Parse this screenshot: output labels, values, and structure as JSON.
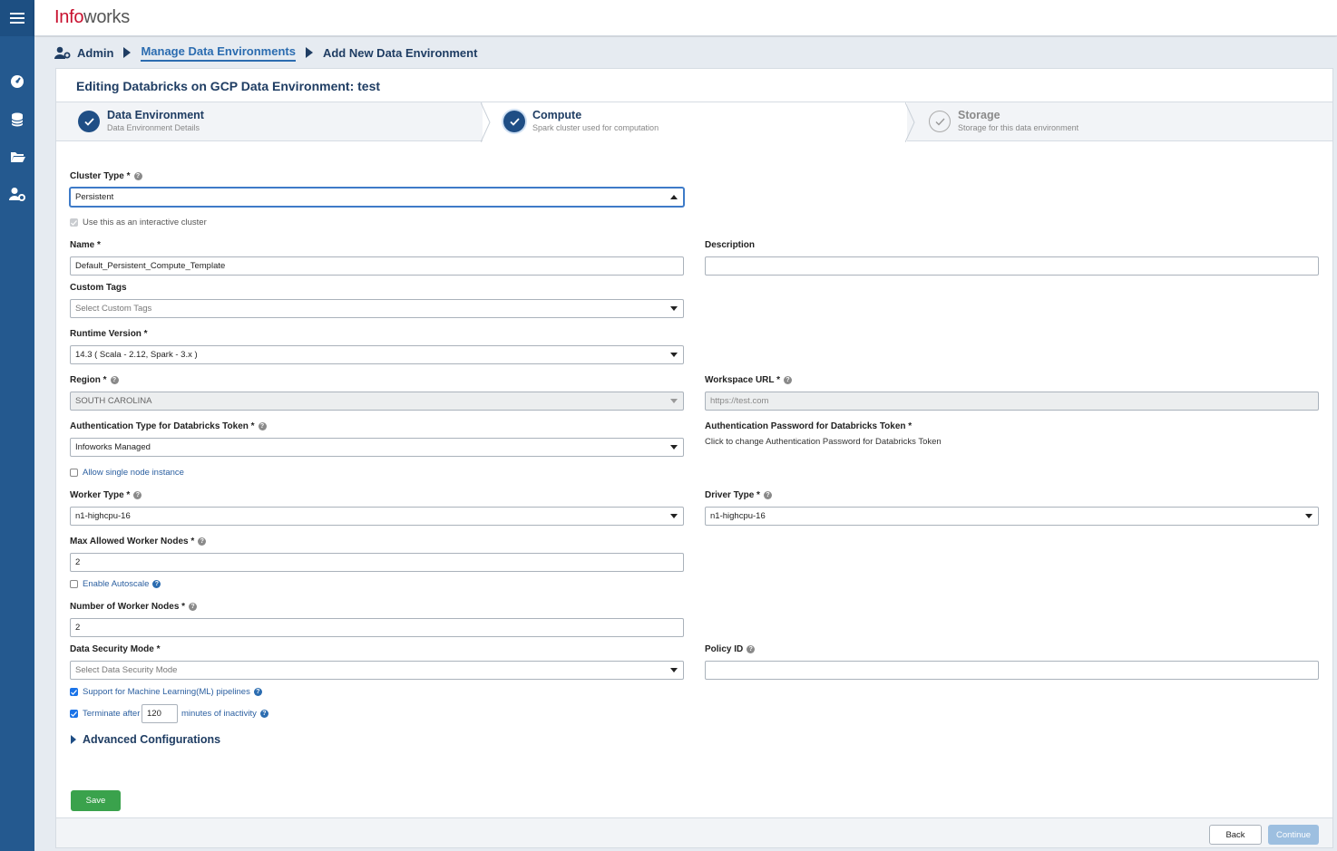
{
  "brand": {
    "logo_part1": "Info",
    "logo_part2": "works"
  },
  "sidebar": {
    "items": [
      {
        "icon": "menu-icon"
      },
      {
        "icon": "dashboard-gauge-icon"
      },
      {
        "icon": "database-icon"
      },
      {
        "icon": "folder-icon"
      },
      {
        "icon": "admin-user-gear-icon"
      }
    ]
  },
  "breadcrumb": {
    "admin": "Admin",
    "manage": "Manage Data Environments",
    "current": "Add New Data Environment"
  },
  "panel": {
    "title": "Editing Databricks on GCP Data Environment: test"
  },
  "stepper": {
    "steps": [
      {
        "title": "Data Environment",
        "subtitle": "Data Environment Details",
        "state": "done"
      },
      {
        "title": "Compute",
        "subtitle": "Spark cluster used for computation",
        "state": "active"
      },
      {
        "title": "Storage",
        "subtitle": "Storage for this data environment",
        "state": "pending"
      }
    ]
  },
  "form": {
    "cluster_type": {
      "label": "Cluster Type *",
      "value": "Persistent"
    },
    "interactive": {
      "label": "Use this as an interactive cluster",
      "checked": true,
      "disabled": true
    },
    "name": {
      "label": "Name *",
      "value": "Default_Persistent_Compute_Template"
    },
    "description": {
      "label": "Description",
      "value": ""
    },
    "custom_tags": {
      "label": "Custom Tags",
      "placeholder": "Select Custom Tags"
    },
    "runtime_version": {
      "label": "Runtime Version *",
      "value": "14.3 ( Scala - 2.12, Spark - 3.x )"
    },
    "region": {
      "label": "Region *",
      "value": "SOUTH CAROLINA"
    },
    "workspace_url": {
      "label": "Workspace URL *",
      "placeholder": "https://test.com"
    },
    "auth_type": {
      "label": "Authentication Type for Databricks Token *",
      "value": "Infoworks Managed"
    },
    "auth_password": {
      "label": "Authentication Password for Databricks Token *",
      "text": "Click to change Authentication Password for Databricks Token"
    },
    "single_node": {
      "label": "Allow single node instance",
      "checked": false
    },
    "worker_type": {
      "label": "Worker Type *",
      "value": "n1-highcpu-16"
    },
    "driver_type": {
      "label": "Driver Type *",
      "value": "n1-highcpu-16"
    },
    "max_workers": {
      "label": "Max Allowed Worker Nodes *",
      "value": "2"
    },
    "autoscale": {
      "label": "Enable Autoscale",
      "checked": false
    },
    "num_workers": {
      "label": "Number of Worker Nodes *",
      "value": "2"
    },
    "security_mode": {
      "label": "Data Security Mode *",
      "placeholder": "Select Data Security Mode"
    },
    "policy_id": {
      "label": "Policy ID",
      "value": ""
    },
    "ml_support": {
      "label": "Support for Machine Learning(ML) pipelines",
      "checked": true
    },
    "terminate": {
      "label_before": "Terminate after",
      "value": "120",
      "label_after": "minutes of inactivity",
      "checked": true
    },
    "advanced": {
      "label": "Advanced Configurations"
    }
  },
  "buttons": {
    "save": "Save",
    "back": "Back",
    "continue": "Continue"
  },
  "colors": {
    "sidebar": "#24598f",
    "primary_dark": "#1f4e85",
    "save_green": "#3aa24c",
    "continue_disabled": "#9dbfe0",
    "brand_red": "#c8102e"
  }
}
